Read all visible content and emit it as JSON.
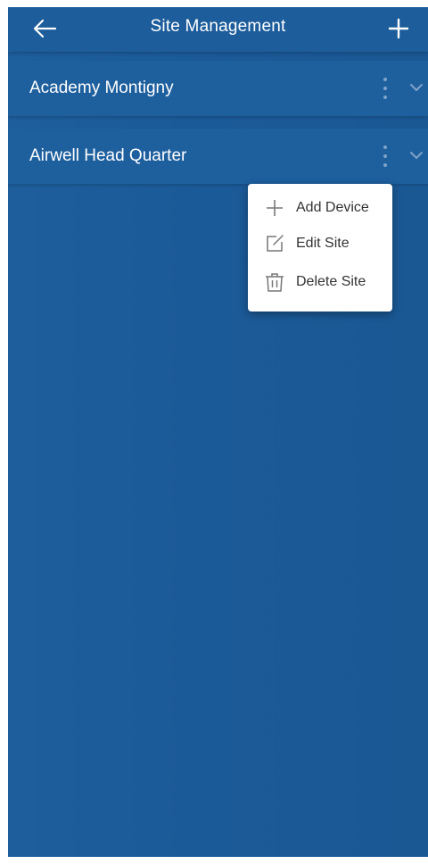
{
  "header": {
    "title": "Site Management",
    "back_icon": "arrow-left-icon",
    "add_icon": "plus-icon"
  },
  "sites": [
    {
      "name": "Academy Montigny"
    },
    {
      "name": "Airwell Head Quarter"
    }
  ],
  "context_menu": {
    "items": [
      {
        "label": "Add Device",
        "icon": "plus-icon"
      },
      {
        "label": "Edit Site",
        "icon": "edit-icon"
      },
      {
        "label": "Delete Site",
        "icon": "trash-icon"
      }
    ]
  },
  "colors": {
    "background": "#1b5a98",
    "header": "#1d5d9b",
    "row": "#1e5f9e",
    "text": "#ffffff",
    "icon_muted": "#7fa3c8",
    "menu_bg": "#ffffff",
    "menu_text": "#333333",
    "menu_icon": "#777777"
  }
}
